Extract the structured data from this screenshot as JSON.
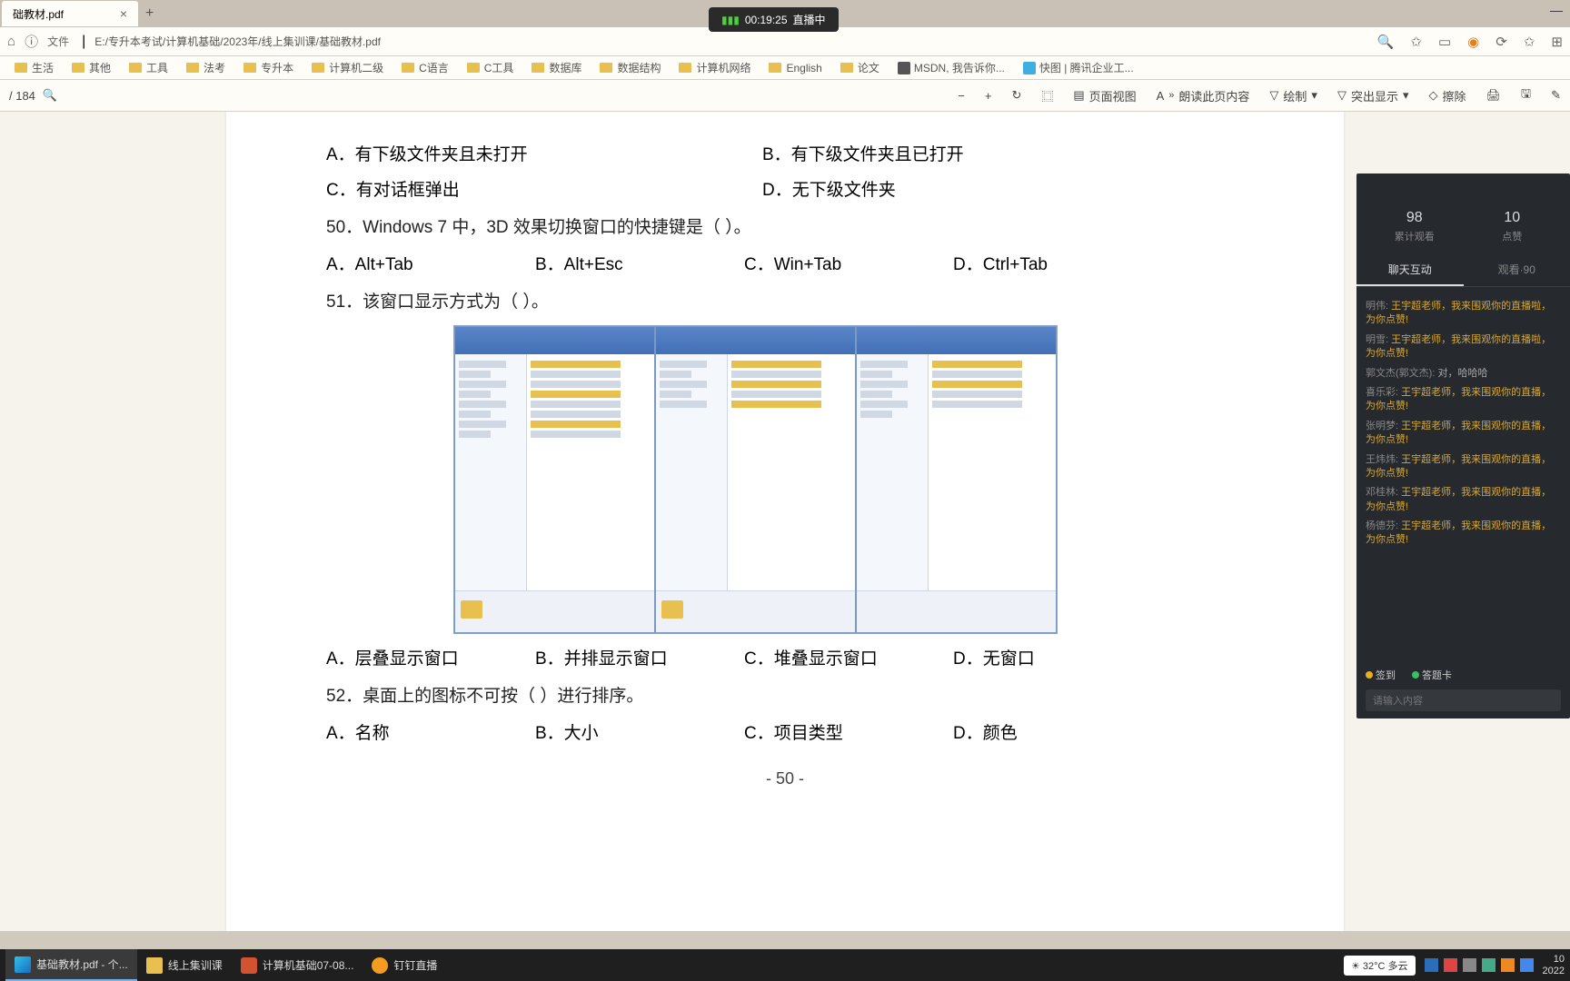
{
  "tab": {
    "title": "础教材.pdf",
    "close": "×",
    "add": "+"
  },
  "win_controls": {
    "min": "—",
    "max": "",
    "close": ""
  },
  "addr": {
    "home": "⌂",
    "info": "ⓘ",
    "label": "文件",
    "path": "E:/专升本考试/计算机基础/2023年/线上集训课/基础教材.pdf",
    "search": "🔍",
    "star": "✩"
  },
  "bookmarks": [
    {
      "label": "生活",
      "type": "folder"
    },
    {
      "label": "其他",
      "type": "folder"
    },
    {
      "label": "工具",
      "type": "folder"
    },
    {
      "label": "法考",
      "type": "folder"
    },
    {
      "label": "专升本",
      "type": "folder"
    },
    {
      "label": "计算机二级",
      "type": "folder"
    },
    {
      "label": "C语言",
      "type": "folder"
    },
    {
      "label": "C工具",
      "type": "folder"
    },
    {
      "label": "数据库",
      "type": "folder"
    },
    {
      "label": "数据结构",
      "type": "folder"
    },
    {
      "label": "计算机网络",
      "type": "folder"
    },
    {
      "label": "English",
      "type": "folder"
    },
    {
      "label": "论文",
      "type": "folder"
    },
    {
      "label": "MSDN, 我告诉你...",
      "type": "ms"
    },
    {
      "label": "快图 | 腾讯企业工...",
      "type": "kf"
    }
  ],
  "pdf_toolbar": {
    "page_total": "/ 184",
    "zoom_out": "−",
    "zoom_in": "+",
    "rotate": "↻",
    "fit": "⿴",
    "page_view": "页面视图",
    "read_aloud": "朗读此页内容",
    "draw": "绘制",
    "highlight": "突出显示",
    "erase": "擦除"
  },
  "questions": {
    "q49_opts": {
      "a": "A．有下级文件夹且未打开",
      "b": "B．有下级文件夹且已打开",
      "c": "C．有对话框弹出",
      "d": "D．无下级文件夹"
    },
    "q50": "50．Windows 7 中，3D 效果切换窗口的快捷键是（        ）。",
    "q50_opts": {
      "a": "A．Alt+Tab",
      "b": "B．Alt+Esc",
      "c": "C．Win+Tab",
      "d": "D．Ctrl+Tab"
    },
    "q51": "51．该窗口显示方式为（        ）。",
    "q51_opts": {
      "a": "A．层叠显示窗口",
      "b": "B．并排显示窗口",
      "c": "C．堆叠显示窗口",
      "d": "D．无窗口"
    },
    "q52": "52．桌面上的图标不可按（        ）进行排序。",
    "q52_opts": {
      "a": "A．名称",
      "b": "B．大小",
      "c": "C．项目类型",
      "d": "D．颜色"
    },
    "page_num": "-  50  -"
  },
  "rec_badge": {
    "time": "00:19:25",
    "label": "直播中"
  },
  "live": {
    "stats": [
      {
        "n": "98",
        "l": "累计观看"
      },
      {
        "n": "10",
        "l": "点赞"
      }
    ],
    "tabs": {
      "chat": "聊天互动",
      "viewers": "观看·90"
    },
    "messages": [
      {
        "name": "明伟:",
        "text": "王宇超老师，我来围观你的直播啦，为你点赞!"
      },
      {
        "name": "明雪:",
        "text": "王宇超老师，我来围观你的直播啦，为你点赞!"
      },
      {
        "name": "郭文杰(郭文杰):",
        "text": "对，哈哈哈",
        "gray": true
      },
      {
        "name": "喜乐彩:",
        "text": "王宇超老师，我来围观你的直播，为你点赞!"
      },
      {
        "name": "张明梦:",
        "text": "王宇超老师，我来围观你的直播，为你点赞!"
      },
      {
        "name": "王炜炜:",
        "text": "王宇超老师，我来围观你的直播，为你点赞!"
      },
      {
        "name": "邓桂林:",
        "text": "王宇超老师，我来围观你的直播，为你点赞!"
      },
      {
        "name": "杨德芬:",
        "text": "王宇超老师，我来围观你的直播，为你点赞!"
      }
    ],
    "foot": {
      "sign": "签到",
      "card": "答题卡"
    },
    "input_placeholder": "请输入内容"
  },
  "taskbar": {
    "items": [
      {
        "label": "基础教材.pdf - 个...",
        "cls": "tb-edge",
        "active": true
      },
      {
        "label": "线上集训课",
        "cls": "tb-f"
      },
      {
        "label": "计算机基础07-08...",
        "cls": "tb-pp"
      },
      {
        "label": "钉钉直播",
        "cls": "tb-dd"
      }
    ],
    "weather": "32°C 多云",
    "time": "10",
    "date": "2022"
  }
}
